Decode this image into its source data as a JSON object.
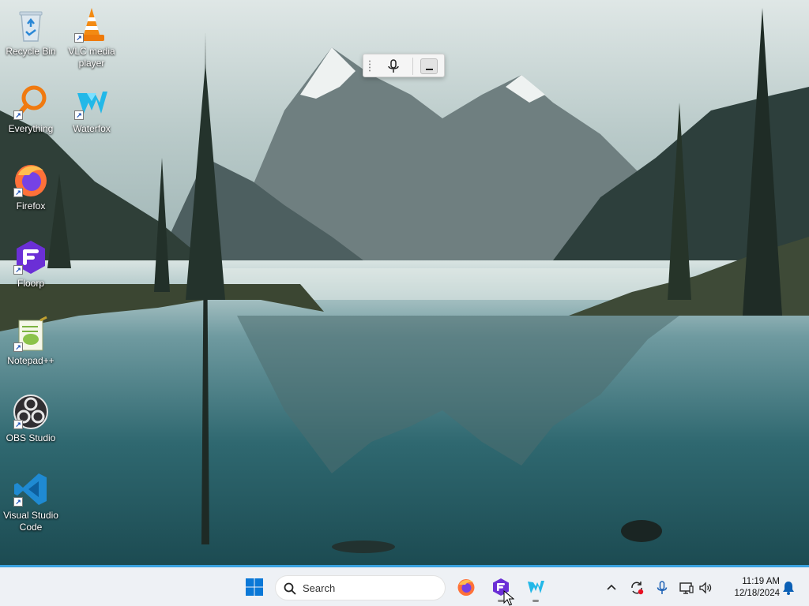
{
  "desktop": {
    "icons": [
      {
        "label": "Recycle Bin",
        "icon": "recycle-bin-icon"
      },
      {
        "label": "VLC media player",
        "icon": "vlc-icon"
      },
      {
        "label": "Everything",
        "icon": "everything-icon"
      },
      {
        "label": "Waterfox",
        "icon": "waterfox-icon"
      },
      {
        "label": "Firefox",
        "icon": "firefox-icon"
      },
      {
        "label": "Floorp",
        "icon": "floorp-icon"
      },
      {
        "label": "Notepad++",
        "icon": "notepadpp-icon"
      },
      {
        "label": "OBS Studio",
        "icon": "obs-icon"
      },
      {
        "label": "Visual Studio Code",
        "icon": "vscode-icon"
      }
    ],
    "wallpaper": "mountain-lake-landscape"
  },
  "voice_toolbar": {
    "mic_icon": "microphone-icon",
    "minimize_icon": "minimize-icon"
  },
  "taskbar": {
    "start_icon": "windows-start-icon",
    "search": {
      "placeholder": "Search"
    },
    "pinned": [
      {
        "name": "Firefox",
        "icon": "firefox-icon"
      },
      {
        "name": "Floorp",
        "icon": "floorp-icon"
      },
      {
        "name": "Waterfox",
        "icon": "waterfox-icon"
      }
    ],
    "tray": {
      "icons": [
        "chevron-up-icon",
        "update-icon",
        "microphone-icon",
        "network-icon",
        "volume-icon"
      ],
      "time": "11:19 AM",
      "date": "12/18/2024",
      "notification_icon": "bell-icon"
    },
    "accent": "#3aa2e0"
  }
}
